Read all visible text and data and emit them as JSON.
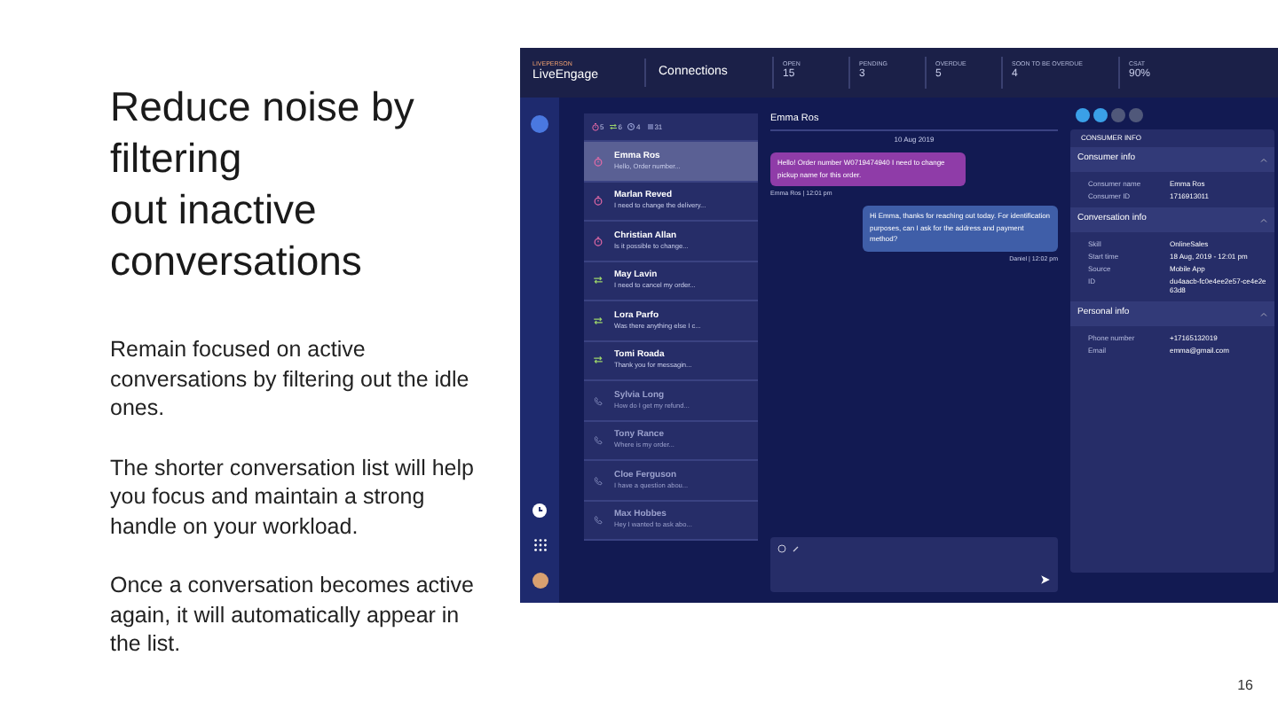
{
  "slide": {
    "title_lines": [
      "Reduce noise by",
      "filtering",
      "out inactive",
      "conversations"
    ],
    "paragraphs": [
      "Remain focused on active conversations by filtering out the idle ones.",
      "The shorter conversation list will help you focus and maintain a strong handle on your workload.",
      "Once a conversation becomes active again, it will automatically appear in the list."
    ],
    "page_number": "16"
  },
  "app": {
    "brand": "LIVEPERSON",
    "product": "LiveEngage",
    "section": "Connections",
    "stats": [
      {
        "label": "OPEN",
        "value": "15"
      },
      {
        "label": "PENDING",
        "value": "3"
      },
      {
        "label": "OVERDUE",
        "value": "5"
      },
      {
        "label": "SOON TO BE OVERDUE",
        "value": "4"
      },
      {
        "label": "CSAT",
        "value": "90%"
      }
    ],
    "filters": [
      {
        "kind": "waiting",
        "count": "5"
      },
      {
        "kind": "transfer",
        "count": "6"
      },
      {
        "kind": "clock",
        "count": "4"
      },
      {
        "kind": "list",
        "count": "31"
      }
    ],
    "conversations": [
      {
        "kind": "waiting",
        "name": "Emma Ros",
        "preview": "Hello, Order number...",
        "selected": true,
        "active": true
      },
      {
        "kind": "waiting",
        "name": "Marlan Reved",
        "preview": "I need to change the delivery...",
        "selected": false,
        "active": true
      },
      {
        "kind": "waiting",
        "name": "Christian Allan",
        "preview": "Is it possible to change...",
        "selected": false,
        "active": true
      },
      {
        "kind": "transfer",
        "name": "May Lavin",
        "preview": "I need to cancel my order...",
        "selected": false,
        "active": true
      },
      {
        "kind": "transfer",
        "name": "Lora Parfo",
        "preview": "Was there anything else I c...",
        "selected": false,
        "active": true
      },
      {
        "kind": "transfer",
        "name": "Tomi Roada",
        "preview": "Thank you for messagin...",
        "selected": false,
        "active": true
      },
      {
        "kind": "idle",
        "name": "Sylvia Long",
        "preview": "How do I get my refund...",
        "selected": false,
        "active": false
      },
      {
        "kind": "idle",
        "name": "Tony Rance",
        "preview": "Where is my order...",
        "selected": false,
        "active": false
      },
      {
        "kind": "idle",
        "name": "Cloe Ferguson",
        "preview": "I have a question abou...",
        "selected": false,
        "active": false
      },
      {
        "kind": "idle",
        "name": "Max Hobbes",
        "preview": "Hey I wanted to ask abo...",
        "selected": false,
        "active": false
      }
    ],
    "chat": {
      "contact": "Emma Ros",
      "date": "10 Aug 2019",
      "messages": [
        {
          "kind": "consumer",
          "text": "Hello! Order number W0719474940 I need to change pickup name for this order.",
          "meta": "Emma Ros | 12:01 pm"
        },
        {
          "kind": "agent",
          "text": "Hi Emma, thanks for reaching out today. For identification purposes, can I ask for the address and payment method?",
          "meta": "Daniel | 12:02 pm"
        }
      ]
    },
    "info": {
      "tab": "CONSUMER INFO",
      "sections": [
        {
          "title": "Consumer info",
          "expanded": true,
          "rows": [
            {
              "label": "Consumer name",
              "value": "Emma Ros"
            },
            {
              "label": "Consumer ID",
              "value": "1716913011"
            }
          ]
        },
        {
          "title": "Conversation info",
          "expanded": true,
          "rows": [
            {
              "label": "Skill",
              "value": "OnlineSales"
            },
            {
              "label": "Start time",
              "value": "18 Aug, 2019 - 12:01 pm"
            },
            {
              "label": "Source",
              "value": "Mobile App"
            },
            {
              "label": "ID",
              "value": "du4aacb-fc0e4ee2e57-ce4e2e63d8"
            }
          ]
        },
        {
          "title": "Personal info",
          "expanded": true,
          "rows": [
            {
              "label": "Phone number",
              "value": "+17165132019"
            },
            {
              "label": "Email",
              "value": "emma@gmail.com"
            }
          ]
        }
      ]
    }
  }
}
